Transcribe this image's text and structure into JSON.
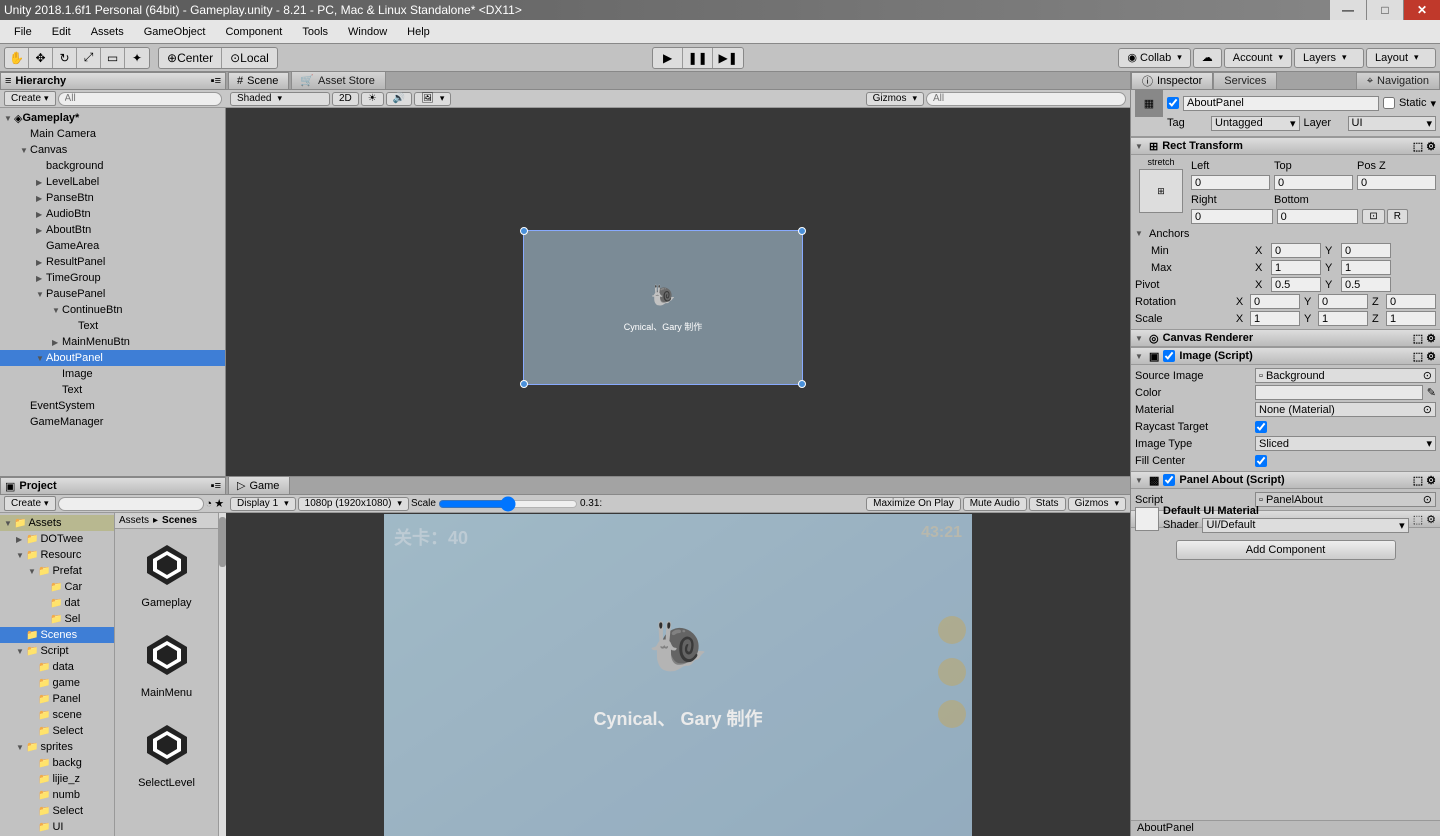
{
  "titlebar": "Unity 2018.1.6f1 Personal (64bit) - Gameplay.unity - 8.21 - PC, Mac & Linux Standalone* <DX11>",
  "menu": [
    "File",
    "Edit",
    "Assets",
    "GameObject",
    "Component",
    "Tools",
    "Window",
    "Help"
  ],
  "toolbar": {
    "center": "Center",
    "local": "Local",
    "collab": "Collab",
    "account": "Account",
    "layers": "Layers",
    "layout": "Layout"
  },
  "hierarchy": {
    "tab": "Hierarchy",
    "create": "Create",
    "search_ph": "All",
    "scene": "Gameplay*",
    "items": [
      {
        "name": "Main Camera",
        "depth": 1,
        "tri": ""
      },
      {
        "name": "Canvas",
        "depth": 1,
        "tri": "open"
      },
      {
        "name": "background",
        "depth": 2,
        "tri": ""
      },
      {
        "name": "LevelLabel",
        "depth": 2,
        "tri": "closed"
      },
      {
        "name": "PanseBtn",
        "depth": 2,
        "tri": "closed"
      },
      {
        "name": "AudioBtn",
        "depth": 2,
        "tri": "closed"
      },
      {
        "name": "AboutBtn",
        "depth": 2,
        "tri": "closed"
      },
      {
        "name": "GameArea",
        "depth": 2,
        "tri": ""
      },
      {
        "name": "ResultPanel",
        "depth": 2,
        "tri": "closed"
      },
      {
        "name": "TimeGroup",
        "depth": 2,
        "tri": "closed"
      },
      {
        "name": "PausePanel",
        "depth": 2,
        "tri": "open"
      },
      {
        "name": "ContinueBtn",
        "depth": 3,
        "tri": "open"
      },
      {
        "name": "Text",
        "depth": 4,
        "tri": ""
      },
      {
        "name": "MainMenuBtn",
        "depth": 3,
        "tri": "closed"
      },
      {
        "name": "AboutPanel",
        "depth": 2,
        "tri": "open",
        "sel": true
      },
      {
        "name": "Image",
        "depth": 3,
        "tri": ""
      },
      {
        "name": "Text",
        "depth": 3,
        "tri": ""
      },
      {
        "name": "EventSystem",
        "depth": 1,
        "tri": ""
      },
      {
        "name": "GameManager",
        "depth": 1,
        "tri": ""
      }
    ]
  },
  "scene": {
    "tab": "Scene",
    "asset_store_tab": "Asset Store",
    "shaded": "Shaded",
    "mode2d": "2D",
    "gizmos": "Gizmos",
    "search_ph": "All"
  },
  "scene_canvas": {
    "text": "Cynical、Gary 制作"
  },
  "game": {
    "tab": "Game",
    "display": "Display 1",
    "res": "1080p (1920x1080)",
    "scale_label": "Scale",
    "scale_val": "0.31:",
    "max": "Maximize On Play",
    "mute": "Mute Audio",
    "stats": "Stats",
    "gizmos": "Gizmos",
    "level": "关卡：40",
    "timer": "43:21",
    "text": "Cynical、 Gary  制作"
  },
  "project": {
    "tab": "Project",
    "create": "Create",
    "crumb_assets": "Assets",
    "crumb_sel": "Scenes",
    "folders": [
      {
        "name": "Assets",
        "depth": 0,
        "tri": "open",
        "hl": true
      },
      {
        "name": "DOTwee",
        "depth": 1,
        "tri": "closed"
      },
      {
        "name": "Resourc",
        "depth": 1,
        "tri": "open"
      },
      {
        "name": "Prefat",
        "depth": 2,
        "tri": "open"
      },
      {
        "name": "Car",
        "depth": 3,
        "tri": ""
      },
      {
        "name": "dat",
        "depth": 3,
        "tri": ""
      },
      {
        "name": "Sel",
        "depth": 3,
        "tri": ""
      },
      {
        "name": "Scenes",
        "depth": 1,
        "tri": "",
        "sel": true
      },
      {
        "name": "Script",
        "depth": 1,
        "tri": "open"
      },
      {
        "name": "data",
        "depth": 2,
        "tri": ""
      },
      {
        "name": "game",
        "depth": 2,
        "tri": ""
      },
      {
        "name": "Panel",
        "depth": 2,
        "tri": ""
      },
      {
        "name": "scene",
        "depth": 2,
        "tri": ""
      },
      {
        "name": "Select",
        "depth": 2,
        "tri": ""
      },
      {
        "name": "sprites",
        "depth": 1,
        "tri": "open"
      },
      {
        "name": "backg",
        "depth": 2,
        "tri": ""
      },
      {
        "name": "lijie_z",
        "depth": 2,
        "tri": ""
      },
      {
        "name": "numb",
        "depth": 2,
        "tri": ""
      },
      {
        "name": "Select",
        "depth": 2,
        "tri": ""
      },
      {
        "name": "UI",
        "depth": 2,
        "tri": ""
      }
    ],
    "assets": [
      "Gameplay",
      "MainMenu",
      "SelectLevel"
    ]
  },
  "inspector": {
    "tab": "Inspector",
    "services_tab": "Services",
    "nav_tab": "Navigation",
    "name": "AboutPanel",
    "static": "Static",
    "tag_label": "Tag",
    "tag_val": "Untagged",
    "layer_label": "Layer",
    "layer_val": "UI",
    "rect": {
      "title": "Rect Transform",
      "mode": "stretch",
      "left_l": "Left",
      "left": "0",
      "top_l": "Top",
      "top": "0",
      "posz_l": "Pos Z",
      "posz": "0",
      "right_l": "Right",
      "right": "0",
      "bottom_l": "Bottom",
      "bottom": "0",
      "anchors_l": "Anchors",
      "min_l": "Min",
      "min_x": "0",
      "min_y": "0",
      "max_l": "Max",
      "max_x": "1",
      "max_y": "1",
      "pivot_l": "Pivot",
      "pivot_x": "0.5",
      "pivot_y": "0.5",
      "rot_l": "Rotation",
      "rot_x": "0",
      "rot_y": "0",
      "rot_z": "0",
      "scale_l": "Scale",
      "scale_x": "1",
      "scale_y": "1",
      "scale_z": "1",
      "R": "R"
    },
    "canvas_r": "Canvas Renderer",
    "image": {
      "title": "Image (Script)",
      "src_l": "Source Image",
      "src": "Background",
      "color_l": "Color",
      "mat_l": "Material",
      "mat": "None (Material)",
      "ray_l": "Raycast Target",
      "type_l": "Image Type",
      "type": "Sliced",
      "fill_l": "Fill Center"
    },
    "panel_about": {
      "title": "Panel About (Script)",
      "script_l": "Script",
      "script": "PanelAbout"
    },
    "material": {
      "name": "Default UI Material",
      "shader_l": "Shader",
      "shader": "UI/Default"
    },
    "add_comp": "Add Component",
    "footer": "AboutPanel"
  }
}
